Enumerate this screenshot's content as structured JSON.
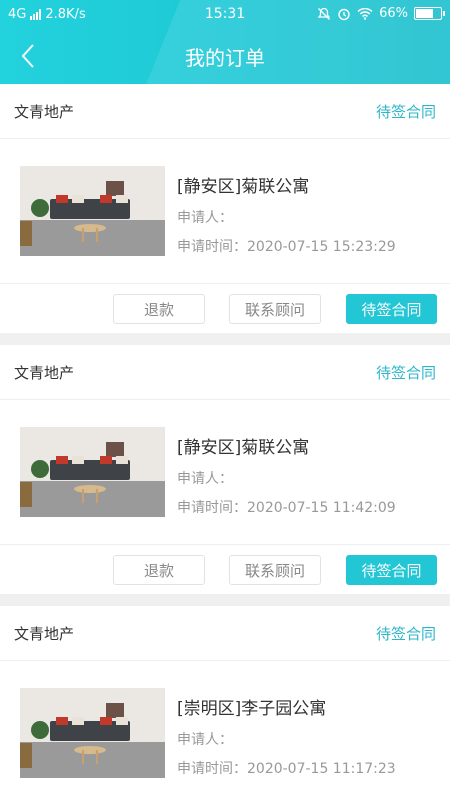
{
  "status_bar": {
    "network": "4G",
    "speed": "2.8K/s",
    "time": "15:31",
    "battery": "66%",
    "battery_level": 0.66
  },
  "nav": {
    "title": "我的订单",
    "back_icon": "chevron-left-icon"
  },
  "colors": {
    "header": "#1fc8d6",
    "accent": "#22c6d4",
    "status_text": "#2bb6c9"
  },
  "orders": [
    {
      "company": "文青地产",
      "status": "待签合同",
      "title": "[静安区]菊联公寓",
      "applicant": "申请人：",
      "apply_time": "申请时间：2020-07-15 15:23:29",
      "actions": {
        "refund": "退款",
        "consult": "联系顾问",
        "sign": "待签合同"
      }
    },
    {
      "company": "文青地产",
      "status": "待签合同",
      "title": "[静安区]菊联公寓",
      "applicant": "申请人：",
      "apply_time": "申请时间：2020-07-15 11:42:09",
      "actions": {
        "refund": "退款",
        "consult": "联系顾问",
        "sign": "待签合同"
      }
    },
    {
      "company": "文青地产",
      "status": "待签合同",
      "title": "[崇明区]李子园公寓",
      "applicant": "申请人：",
      "apply_time": "申请时间：2020-07-15 11:17:23"
    }
  ]
}
